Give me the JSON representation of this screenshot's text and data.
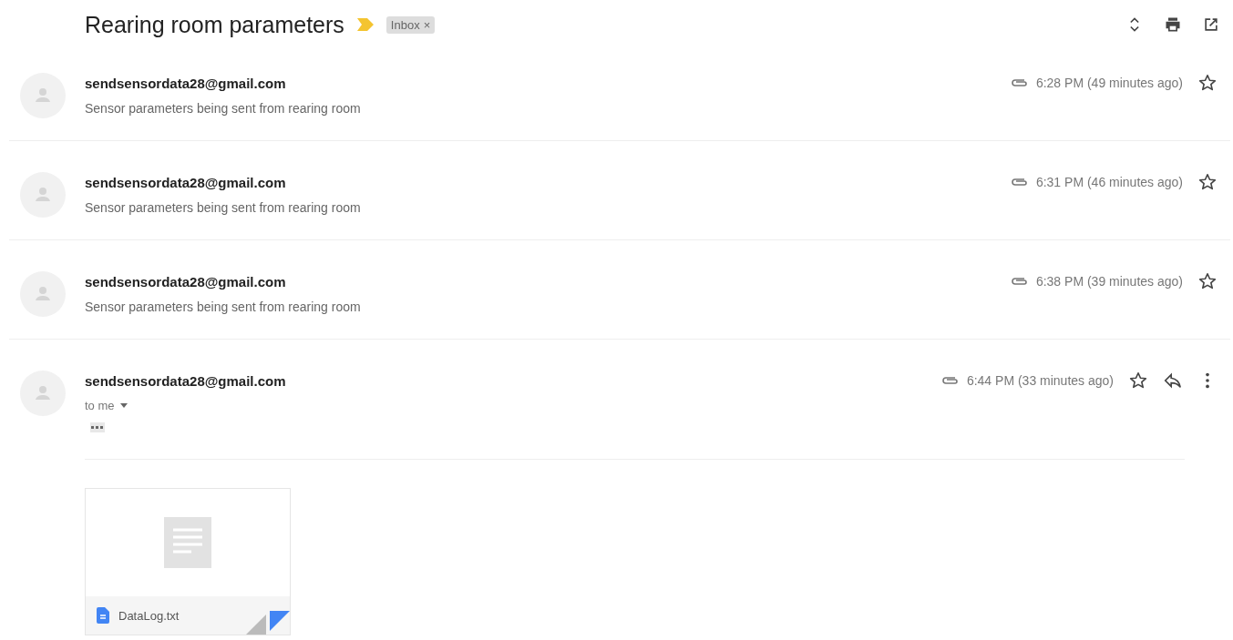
{
  "subject": "Rearing room parameters",
  "label": {
    "text": "Inbox",
    "remove": "×"
  },
  "messages": [
    {
      "sender": "sendsensordata28@gmail.com",
      "snippet": "Sensor parameters being sent from rearing room",
      "time": "6:28 PM (49 minutes ago)",
      "expanded": false,
      "starred": false
    },
    {
      "sender": "sendsensordata28@gmail.com",
      "snippet": "Sensor parameters being sent from rearing room",
      "time": "6:31 PM (46 minutes ago)",
      "expanded": false,
      "starred": false
    },
    {
      "sender": "sendsensordata28@gmail.com",
      "snippet": "Sensor parameters being sent from rearing room",
      "time": "6:38 PM (39 minutes ago)",
      "expanded": false,
      "starred": false
    },
    {
      "sender": "sendsensordata28@gmail.com",
      "recipient": "to me",
      "time": "6:44 PM (33 minutes ago)",
      "expanded": true,
      "starred": false,
      "attachment": {
        "name": "DataLog.txt"
      }
    }
  ]
}
